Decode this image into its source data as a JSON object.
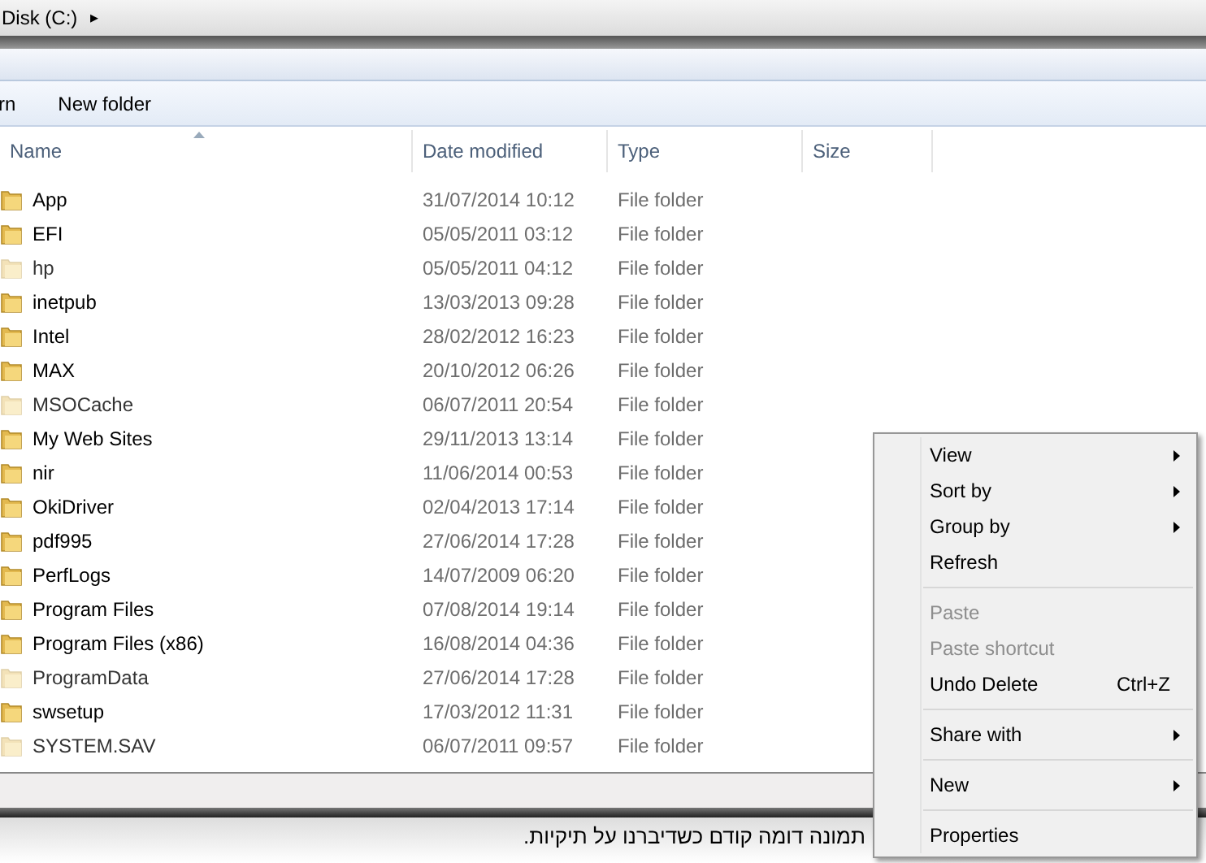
{
  "breadcrumb": {
    "text": "Disk (C:)",
    "arrow": "▸"
  },
  "toolbar": {
    "items": [
      "rn",
      "New folder"
    ]
  },
  "table": {
    "columns": [
      "Name",
      "Date modified",
      "Type",
      "Size"
    ],
    "rows": [
      {
        "name": "App",
        "date": "31/07/2014 10:12",
        "type": "File folder",
        "hidden": false
      },
      {
        "name": "EFI",
        "date": "05/05/2011 03:12",
        "type": "File folder",
        "hidden": false
      },
      {
        "name": "hp",
        "date": "05/05/2011 04:12",
        "type": "File folder",
        "hidden": true
      },
      {
        "name": "inetpub",
        "date": "13/03/2013 09:28",
        "type": "File folder",
        "hidden": false
      },
      {
        "name": "Intel",
        "date": "28/02/2012 16:23",
        "type": "File folder",
        "hidden": false
      },
      {
        "name": "MAX",
        "date": "20/10/2012 06:26",
        "type": "File folder",
        "hidden": false
      },
      {
        "name": "MSOCache",
        "date": "06/07/2011 20:54",
        "type": "File folder",
        "hidden": true
      },
      {
        "name": "My Web Sites",
        "date": "29/11/2013 13:14",
        "type": "File folder",
        "hidden": false
      },
      {
        "name": "nir",
        "date": "11/06/2014 00:53",
        "type": "File folder",
        "hidden": false
      },
      {
        "name": "OkiDriver",
        "date": "02/04/2013 17:14",
        "type": "File folder",
        "hidden": false
      },
      {
        "name": "pdf995",
        "date": "27/06/2014 17:28",
        "type": "File folder",
        "hidden": false
      },
      {
        "name": "PerfLogs",
        "date": "14/07/2009 06:20",
        "type": "File folder",
        "hidden": false
      },
      {
        "name": "Program Files",
        "date": "07/08/2014 19:14",
        "type": "File folder",
        "hidden": false
      },
      {
        "name": "Program Files (x86)",
        "date": "16/08/2014 04:36",
        "type": "File folder",
        "hidden": false
      },
      {
        "name": "ProgramData",
        "date": "27/06/2014 17:28",
        "type": "File folder",
        "hidden": true
      },
      {
        "name": "swsetup",
        "date": "17/03/2012 11:31",
        "type": "File folder",
        "hidden": false
      },
      {
        "name": "SYSTEM.SAV",
        "date": "06/07/2011 09:57",
        "type": "File folder",
        "hidden": true
      }
    ]
  },
  "context_menu": {
    "items": [
      {
        "kind": "item",
        "label": "View",
        "submenu": true,
        "disabled": false
      },
      {
        "kind": "item",
        "label": "Sort by",
        "submenu": true,
        "disabled": false
      },
      {
        "kind": "item",
        "label": "Group by",
        "submenu": true,
        "disabled": false
      },
      {
        "kind": "item",
        "label": "Refresh",
        "submenu": false,
        "disabled": false
      },
      {
        "kind": "separator"
      },
      {
        "kind": "item",
        "label": "Paste",
        "submenu": false,
        "disabled": true
      },
      {
        "kind": "item",
        "label": "Paste shortcut",
        "submenu": false,
        "disabled": true
      },
      {
        "kind": "item",
        "label": "Undo Delete",
        "shortcut": "Ctrl+Z",
        "submenu": false,
        "disabled": false
      },
      {
        "kind": "separator"
      },
      {
        "kind": "item",
        "label": "Share with",
        "submenu": true,
        "disabled": false
      },
      {
        "kind": "separator"
      },
      {
        "kind": "item",
        "label": "New",
        "submenu": true,
        "disabled": false
      },
      {
        "kind": "separator"
      },
      {
        "kind": "item",
        "label": "Properties",
        "submenu": false,
        "disabled": false
      }
    ]
  },
  "page_text": "תמונה דומה קודם כשדיברנו על תיקיות."
}
